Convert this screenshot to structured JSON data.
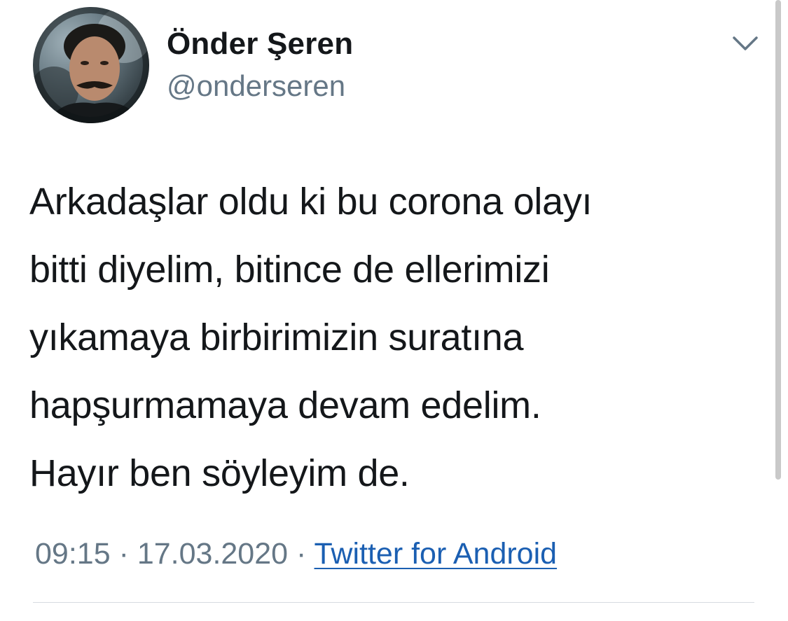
{
  "author": {
    "display_name": "Önder Şeren",
    "handle": "@onderseren"
  },
  "tweet": {
    "text": "Arkadaşlar oldu ki bu corona olayı\nbitti diyelim, bitince de ellerimizi\nyıkamaya birbirimizin suratına\nhapşurmamaya devam edelim.\nHayır ben söyleyim de.",
    "time": "09:15",
    "date": "17.03.2020",
    "separator": "·",
    "source": "Twitter for Android"
  },
  "icons": {
    "menu": "chevron-down-icon",
    "avatar": "user-avatar"
  },
  "colors": {
    "text": "#14171a",
    "secondary": "#657786",
    "link": "#1b5fb2",
    "divider": "#d6dbe0"
  }
}
